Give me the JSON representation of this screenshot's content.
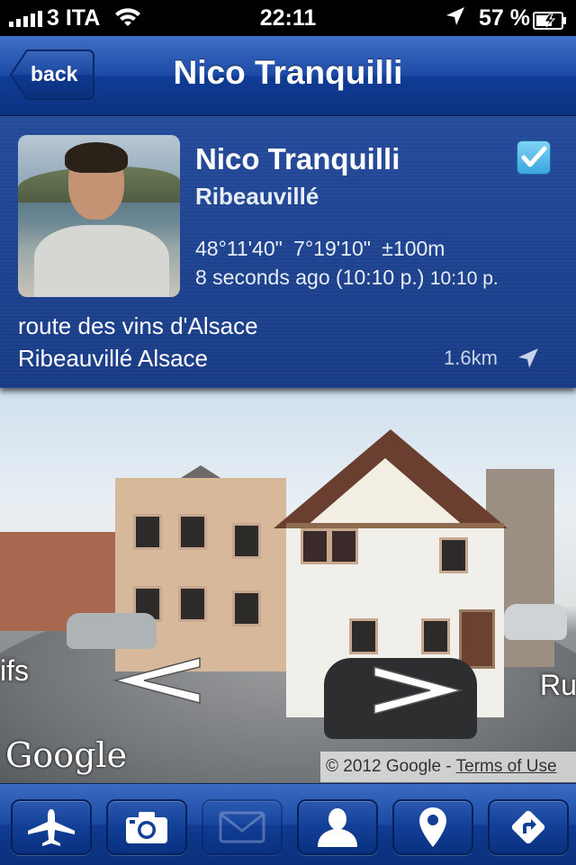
{
  "status_bar": {
    "carrier": "3 ITA",
    "time": "22:11",
    "battery_percent": "57 %",
    "signal_bars": 5
  },
  "nav": {
    "back_label": "back",
    "title": "Nico Tranquilli"
  },
  "profile": {
    "name": "Nico Tranquilli",
    "town": "Ribeauvillé",
    "coordinates": "48°11'40\"  7°19'10\"  ±100m",
    "time_ago": "8 seconds ago (10:10 p.)",
    "time_clock": "10:10 p.",
    "address_line1": "route des vins d'Alsace",
    "address_line2": "Ribeauvillé Alsace",
    "distance": "1.6km",
    "checkin_icon": "checkbox-checked-icon"
  },
  "street_view": {
    "left_street_label": "ifs",
    "right_street_label": "Ru",
    "google_logo": "Google",
    "copyright": "© 2012 Google - ",
    "terms_link": "Terms of Use"
  },
  "toolbar": {
    "buttons": [
      {
        "icon": "airplane-icon",
        "enabled": true
      },
      {
        "icon": "camera-icon",
        "enabled": true
      },
      {
        "icon": "mail-icon",
        "enabled": false
      },
      {
        "icon": "person-icon",
        "enabled": true
      },
      {
        "icon": "map-pin-icon",
        "enabled": true
      },
      {
        "icon": "directions-icon",
        "enabled": true
      }
    ]
  },
  "colors": {
    "nav_blue": "#1c4aa6",
    "panel_blue": "#1f4490",
    "text_white": "#ffffff"
  }
}
